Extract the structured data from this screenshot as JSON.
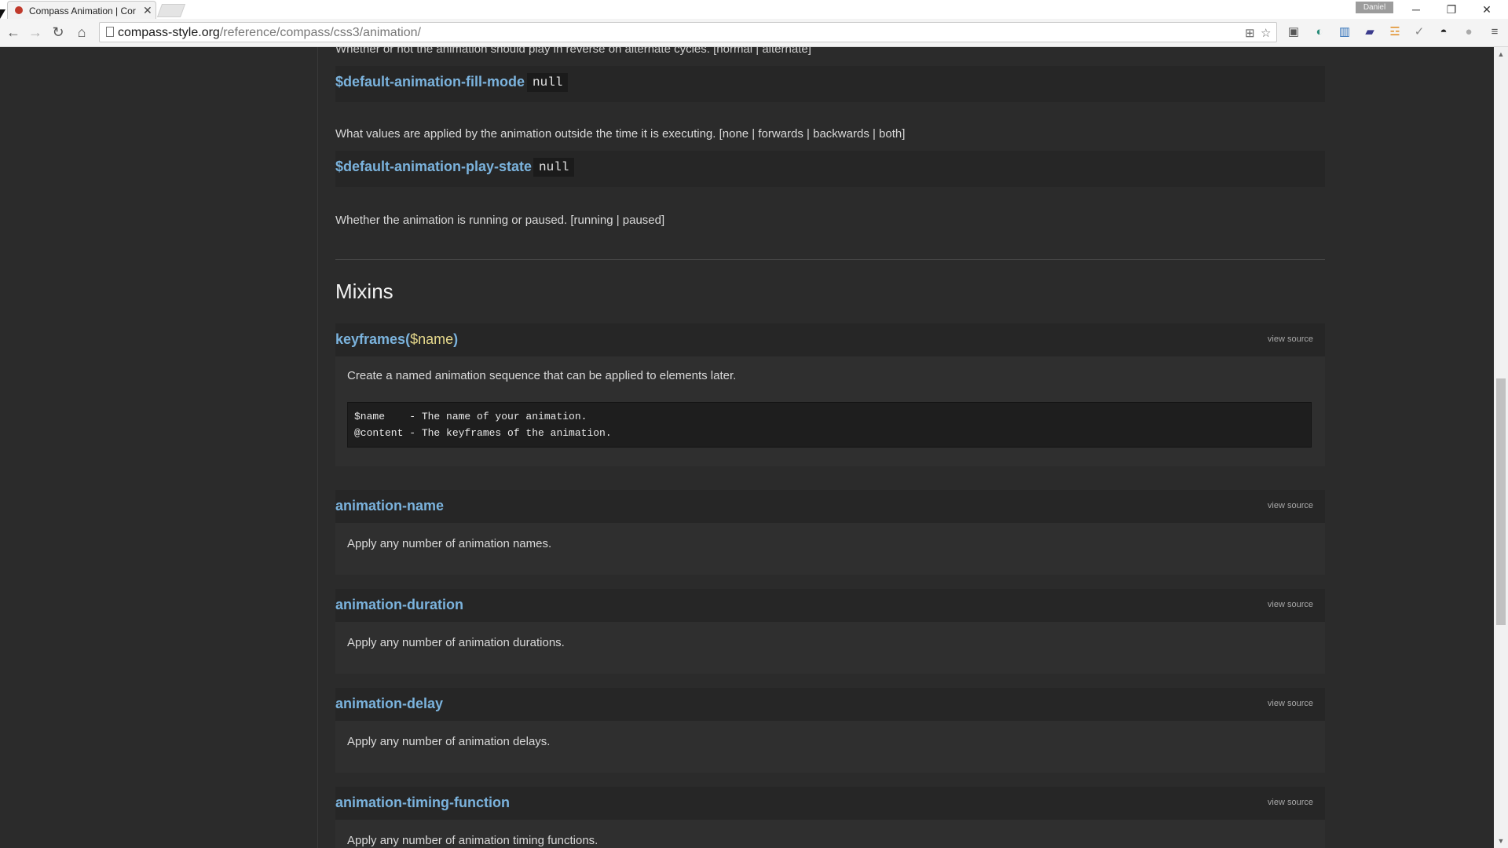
{
  "browser": {
    "tab_title": "Compass Animation | Cor",
    "tab_close": "✕",
    "profile": "Daniel",
    "window_controls": {
      "minimize": "─",
      "restore": "❐",
      "close": "✕"
    },
    "url_host": "compass-style.org",
    "url_path": "/reference/compass/css3/animation/",
    "nav": {
      "back": "←",
      "forward": "→",
      "reload": "↻",
      "home": "⌂"
    },
    "icons": [
      "translate-icon",
      "bookmark-star-icon",
      "extension-icons",
      "menu-icon"
    ]
  },
  "page": {
    "top_partial_text": "Whether or not the animation should play in reverse on alternate cycles. [normal | alternate]",
    "variables": [
      {
        "name": "$default-animation-fill-mode",
        "value": "null",
        "description": "What values are applied by the animation outside the time it is executing. [none | forwards | backwards | both]"
      },
      {
        "name": "$default-animation-play-state",
        "value": "null",
        "description": "Whether the animation is running or paused. [running | paused]"
      }
    ],
    "section_title": "Mixins",
    "view_source_label": "view source",
    "mixins": [
      {
        "name": "keyframes(",
        "arg": "$name",
        "close": ")",
        "description": "Create a named animation sequence that can be applied to elements later.",
        "code_lines": [
          "$name    - The name of your animation.",
          "@content - The keyframes of the animation."
        ]
      },
      {
        "name": "animation-name",
        "description": "Apply any number of animation names."
      },
      {
        "name": "animation-duration",
        "description": "Apply any number of animation durations."
      },
      {
        "name": "animation-delay",
        "description": "Apply any number of animation delays."
      },
      {
        "name": "animation-timing-function",
        "description": "Apply any number of animation timing functions."
      }
    ]
  },
  "colors": {
    "background": "#2b2b2b",
    "link": "#7bb3dd",
    "argument": "#e6d98c",
    "text": "#d9d9d9"
  }
}
